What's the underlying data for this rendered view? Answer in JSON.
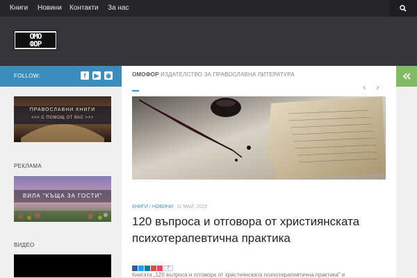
{
  "topnav": {
    "items": [
      "Книги",
      "Новини",
      "Контакти",
      "За нас"
    ]
  },
  "logo": {
    "text_top": "ОМО",
    "text_bottom": "ФОР"
  },
  "sidebar": {
    "follow_label": "FOLLOW:",
    "social_icons": [
      "facebook-icon",
      "youtube-icon",
      "rss-icon"
    ],
    "banner1": {
      "line1": "ПРАВОСЛАВНИ КНИГИ",
      "line2": "<<< С ПОМОЩ ОТ ВАС >>>"
    },
    "ads_heading": "РЕКЛАМА",
    "banner2": {
      "text": "ВИЛА \"КЪЩА ЗА ГОСТИ\""
    },
    "video_heading": "ВИДЕО"
  },
  "main": {
    "subheader_strong": "ОМОФОР",
    "subheader_rest": " ИЗДАТЕЛСТВО ЗА ПРАВОСЛАВНА ЛИТЕРАТУРА",
    "categories": [
      "КНИГИ",
      "НОВИНИ"
    ],
    "category_sep": " / ",
    "date": "11 МАЙ, 2015",
    "title": "120 въпроса и отговора от християнската психотерапевтична практика",
    "share_count": "7",
    "excerpt": "Книгата „120 въпроса и отговора от християнската психотерапевтична практика\" е"
  },
  "colors": {
    "accent": "#3b8dbd",
    "toggle": "#82b965",
    "topbar": "#26272b",
    "header": "#34363b"
  }
}
